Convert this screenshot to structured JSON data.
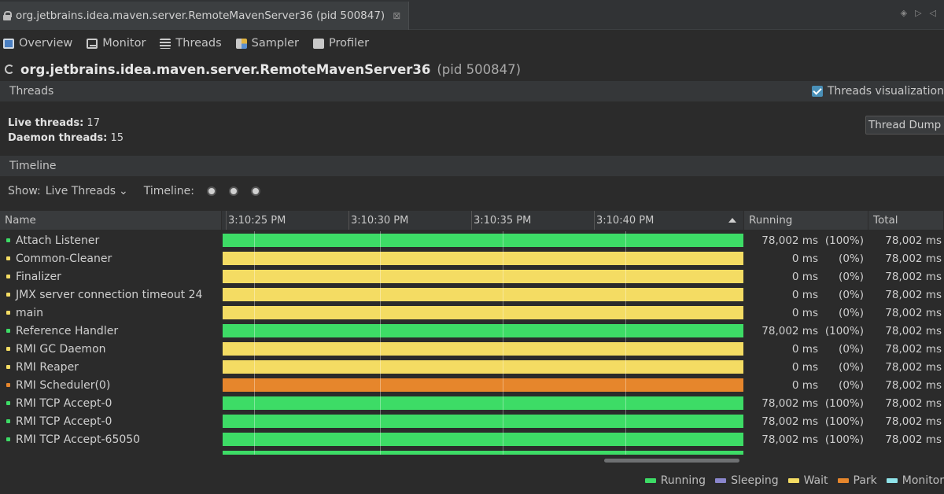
{
  "window": {
    "tab_title": "org.jetbrains.idea.maven.server.RemoteMavenServer36 (pid 500847)"
  },
  "view_tabs": [
    {
      "label": "Overview",
      "icon": "overview-icon"
    },
    {
      "label": "Monitor",
      "icon": "monitor-icon"
    },
    {
      "label": "Threads",
      "icon": "threads-icon"
    },
    {
      "label": "Sampler",
      "icon": "sampler-icon"
    },
    {
      "label": "Profiler",
      "icon": "profiler-icon"
    }
  ],
  "process": {
    "name": "org.jetbrains.idea.maven.server.RemoteMavenServer36",
    "pid": "(pid 500847)"
  },
  "threads_section": {
    "title": "Threads",
    "visualization_label": "Threads visualization",
    "visualization_checked": true,
    "live_label": "Live threads:",
    "live_value": "17",
    "daemon_label": "Daemon threads:",
    "daemon_value": "15",
    "dump_button": "Thread Dump"
  },
  "timeline_section": {
    "title": "Timeline",
    "show_label": "Show:",
    "show_value": "Live Threads",
    "timeline_label": "Timeline:"
  },
  "table": {
    "columns": {
      "name": "Name",
      "running": "Running",
      "total": "Total"
    },
    "ticks": [
      "3:10:25 PM",
      "3:10:30 PM",
      "3:10:35 PM",
      "3:10:40 PM"
    ],
    "rows": [
      {
        "name": "Attach Listener",
        "state": "running",
        "running_ms": "78,002 ms",
        "running_pct": "(100%)",
        "total": "78,002 ms"
      },
      {
        "name": "Common-Cleaner",
        "state": "wait",
        "running_ms": "0 ms",
        "running_pct": "(0%)",
        "total": "78,002 ms"
      },
      {
        "name": "Finalizer",
        "state": "wait",
        "running_ms": "0 ms",
        "running_pct": "(0%)",
        "total": "78,002 ms"
      },
      {
        "name": "JMX server connection timeout 24",
        "state": "wait",
        "running_ms": "0 ms",
        "running_pct": "(0%)",
        "total": "78,002 ms"
      },
      {
        "name": "main",
        "state": "wait",
        "running_ms": "0 ms",
        "running_pct": "(0%)",
        "total": "78,002 ms"
      },
      {
        "name": "Reference Handler",
        "state": "running",
        "running_ms": "78,002 ms",
        "running_pct": "(100%)",
        "total": "78,002 ms"
      },
      {
        "name": "RMI GC Daemon",
        "state": "wait",
        "running_ms": "0 ms",
        "running_pct": "(0%)",
        "total": "78,002 ms"
      },
      {
        "name": "RMI Reaper",
        "state": "wait",
        "running_ms": "0 ms",
        "running_pct": "(0%)",
        "total": "78,002 ms"
      },
      {
        "name": "RMI Scheduler(0)",
        "state": "park",
        "running_ms": "0 ms",
        "running_pct": "(0%)",
        "total": "78,002 ms"
      },
      {
        "name": "RMI TCP Accept-0",
        "state": "running",
        "running_ms": "78,002 ms",
        "running_pct": "(100%)",
        "total": "78,002 ms"
      },
      {
        "name": "RMI TCP Accept-0",
        "state": "running",
        "running_ms": "78,002 ms",
        "running_pct": "(100%)",
        "total": "78,002 ms"
      },
      {
        "name": "RMI TCP Accept-65050",
        "state": "running",
        "running_ms": "78,002 ms",
        "running_pct": "(100%)",
        "total": "78,002 ms"
      },
      {
        "name": "",
        "state": "running",
        "running_ms": "",
        "running_pct": "",
        "total": ""
      }
    ]
  },
  "legend": [
    {
      "label": "Running",
      "state": "running"
    },
    {
      "label": "Sleeping",
      "state": "sleeping"
    },
    {
      "label": "Wait",
      "state": "wait"
    },
    {
      "label": "Park",
      "state": "park"
    },
    {
      "label": "Monitor",
      "state": "monitor"
    }
  ],
  "colors": {
    "running": "#3ddc66",
    "sleeping": "#8a86cc",
    "wait": "#f4dc63",
    "park": "#e6862c",
    "monitor": "#8fe3e9"
  }
}
